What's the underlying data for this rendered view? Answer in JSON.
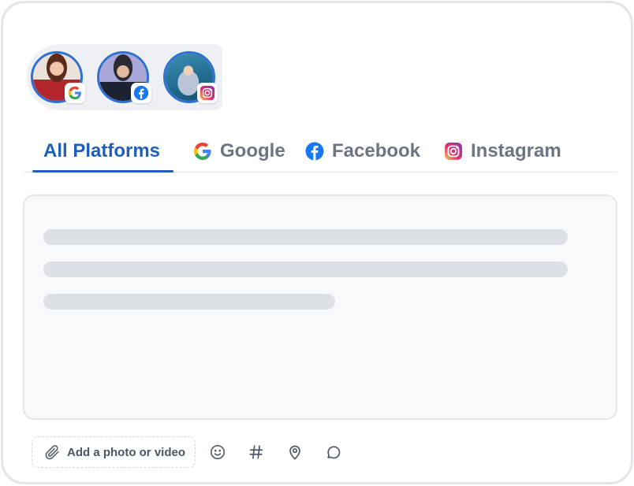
{
  "avatars": [
    {
      "name": "avatar-google",
      "platform": "google",
      "ring_color": "#2f6fd0"
    },
    {
      "name": "avatar-facebook",
      "platform": "facebook",
      "ring_color": "#2f6fd0"
    },
    {
      "name": "avatar-instagram",
      "platform": "instagram",
      "ring_color": "#2f6fd0"
    }
  ],
  "tabs": {
    "all": {
      "label": "All Platforms",
      "active": true
    },
    "google": {
      "label": "Google",
      "icon": "google-icon"
    },
    "facebook": {
      "label": "Facebook",
      "icon": "facebook-icon"
    },
    "instagram": {
      "label": "Instagram",
      "icon": "instagram-icon"
    }
  },
  "toolbar": {
    "attach_label": "Add a photo or video",
    "attach_icon": "paperclip-icon",
    "tools": [
      "emoji-icon",
      "hashtag-icon",
      "location-pin-icon",
      "comment-icon"
    ]
  },
  "colors": {
    "accent": "#1f5fb8",
    "tab_inactive": "#6d7583",
    "skeleton": "#dde1e7",
    "editor_bg": "#f8f9fa",
    "facebook": "#1877f2"
  }
}
